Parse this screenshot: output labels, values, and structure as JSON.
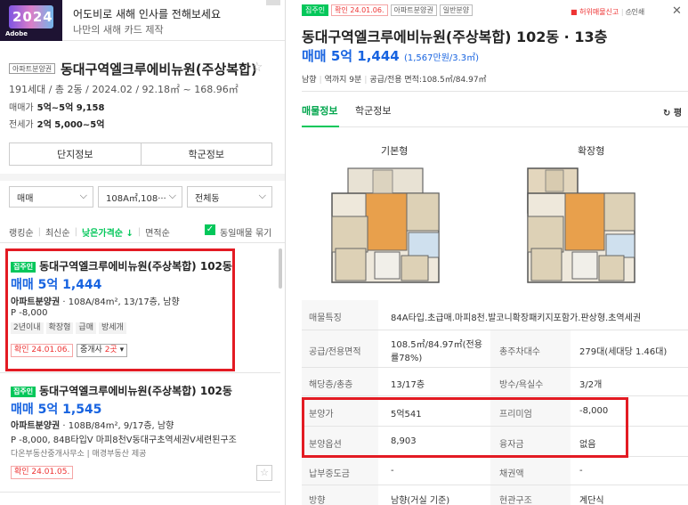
{
  "ad": {
    "thumb_text": "2024",
    "brand": "Adobe",
    "title": "어도비로 새해 인사를 전해보세요",
    "subtitle": "나만의 새해 카드 제작"
  },
  "complex": {
    "type_tag": "아파트분양권",
    "name": "동대구역엘크루에비뉴원(주상복합)",
    "star": "☆",
    "summary": "191세대 / 총 2동 / 2024.02 / 92.18㎡ ~ 168.96㎡",
    "sale_label": "매매가",
    "sale_range": "5억~5억 9,158",
    "rent_label": "전세가",
    "rent_range": "2억 5,000~5억",
    "btn_info": "단지정보",
    "btn_school": "학군정보"
  },
  "filters": {
    "deal": "매매",
    "area": "108A㎡,108···",
    "dong": "전체동"
  },
  "sort": {
    "s1": "랭킹순",
    "s2": "최신순",
    "s3": "낮은가격순 ↓",
    "s4": "면적순",
    "same_listing": "동일매물 묶기"
  },
  "listings": [
    {
      "tag": "집주인",
      "title": "동대구역엘크루에비뉴원(주상복합) 102동",
      "price": "매매 5억 1,444",
      "spec_bold": "아파트분양권",
      "spec": " · 108A/84m², 13/17층, 남향",
      "p": "P -8,000",
      "tags": [
        "2년이내",
        "확장형",
        "급매",
        "방세개"
      ],
      "confirm": "확인 24.01.06.",
      "agent_prefix": "중개사 ",
      "agent_count": "2곳",
      "agent_suffix": " ▾"
    },
    {
      "tag": "집주인",
      "title": "동대구역엘크루에비뉴원(주상복합) 102동",
      "price": "매매 5억 1,545",
      "spec_bold": "아파트분양권",
      "spec": " · 108B/84m², 9/17층, 남향",
      "p": "P -8,000, 84B타입V 마피8천V동대구초역세권V세련된구조",
      "source": "다온부동산중개사무소 | 매경부동산 제공",
      "confirm": "확인 24.01.05.",
      "star": "☆"
    }
  ],
  "detail": {
    "tags": [
      "집주인",
      "확인 24.01.06.",
      "아파트분양권",
      "일반분양"
    ],
    "report": "허위매물신고",
    "print": "인쇄",
    "close": "✕",
    "title": "동대구역엘크루에비뉴원(주상복합) 102동 · 13층",
    "price": "매매 5억 1,444",
    "price_per": "(1,567만원/3.3㎡)",
    "meta_dir": "남향",
    "meta_station": "역까지 9분",
    "meta_area": "공급/전용 면적:108.5㎡/84.97㎡",
    "tab1": "매물정보",
    "tab2": "학군정보",
    "refresh": "↻ 평",
    "fp1": "기본형",
    "fp2": "확장형"
  },
  "table": {
    "feature_k": "매물특징",
    "feature_v": "84A타입.초급매.마피8천.발코니확장패키지포함가.판상형.초역세권",
    "area_k": "공급/전용면적",
    "area_v1": "108.5㎡/84.97㎡(전용",
    "area_v2": "률78%)",
    "households_k": "총주차대수",
    "households_v": "279대(세대당 1.46대)",
    "floor_k": "해당층/총층",
    "floor_v": "13/17층",
    "rooms_k": "방수/욕실수",
    "rooms_v": "3/2개",
    "presale_k": "분양가",
    "presale_v": "5억541",
    "premium_k": "프리미엄",
    "premium_v": "-8,000",
    "option_k": "분양옵션",
    "option_v": "8,903",
    "loan_k": "융자금",
    "loan_v": "없음",
    "paid_k": "납부중도금",
    "paid_v": "-",
    "debt_k": "채권액",
    "debt_v": "-",
    "dir_k": "방향",
    "dir_v": "남향(거실 기준)",
    "struct_k": "현관구조",
    "struct_v": "계단식"
  }
}
